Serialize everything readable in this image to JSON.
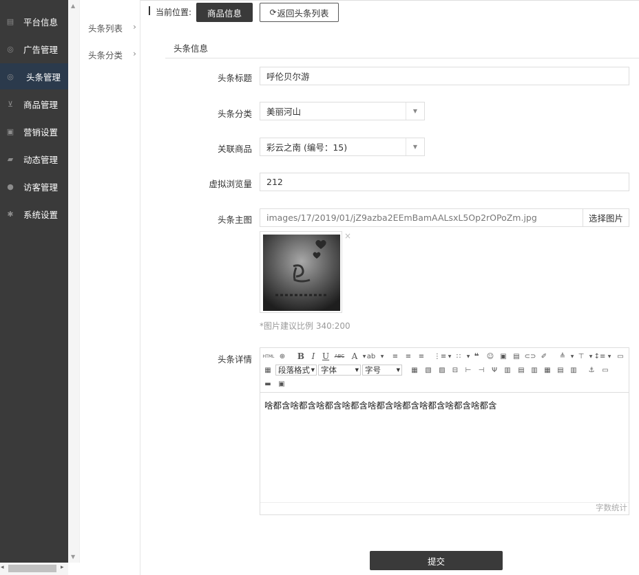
{
  "sidebar": {
    "items": [
      {
        "label": "平台信息",
        "icon": "newspaper-icon"
      },
      {
        "label": "广告管理",
        "icon": "lifebuoy-icon"
      },
      {
        "label": "头条管理",
        "icon": "lifebuoy-icon"
      },
      {
        "label": "商品管理",
        "icon": "cart-icon"
      },
      {
        "label": "营销设置",
        "icon": "gift-icon"
      },
      {
        "label": "动态管理",
        "icon": "book-icon"
      },
      {
        "label": "访客管理",
        "icon": "user-icon"
      },
      {
        "label": "系统设置",
        "icon": "gear-icon"
      }
    ],
    "active_index": 2
  },
  "subnav": {
    "items": [
      {
        "label": "头条列表",
        "chevron": "›"
      },
      {
        "label": "头条分类",
        "chevron": "›"
      }
    ]
  },
  "breadcrumb": {
    "label": "当前位置:",
    "current": "商品信息",
    "back": "返回头条列表",
    "back_icon": "⟳"
  },
  "section": {
    "title": "头条信息"
  },
  "form": {
    "title_label": "头条标题",
    "title_value": "呼伦贝尔游",
    "category_label": "头条分类",
    "category_value": "美丽河山",
    "product_label": "关联商品",
    "product_value": "彩云之南 (编号：15)",
    "views_label": "虚拟浏览量",
    "views_value": "212",
    "image_label": "头条主图",
    "image_path": "images/17/2019/01/jZ9azba2EEmBamAALsxL5Op2rOPoZm.jpg",
    "choose_button": "选择图片",
    "image_close": "×",
    "image_hint": "*图片建议比例 340:200",
    "detail_label": "头条详情"
  },
  "editor": {
    "paragraph_select": "段落格式",
    "font_select": "字体",
    "size_select": "字号",
    "body_text": "啥都含啥都含啥都含啥都含啥都含啥都含啥都含啥都含啥都含",
    "word_count": "字数统计",
    "toolbar_glyphs": {
      "html": "HTML",
      "bold": "B",
      "italic": "I",
      "underline": "U",
      "strike": "ABC",
      "fontcolor": "A",
      "quote": "❝"
    }
  },
  "submit_label": "提交",
  "colors": {
    "sidebar_bg": "#3a3a3a",
    "active_bg": "#2b3a4c",
    "button_dark": "#3a3a3a"
  }
}
